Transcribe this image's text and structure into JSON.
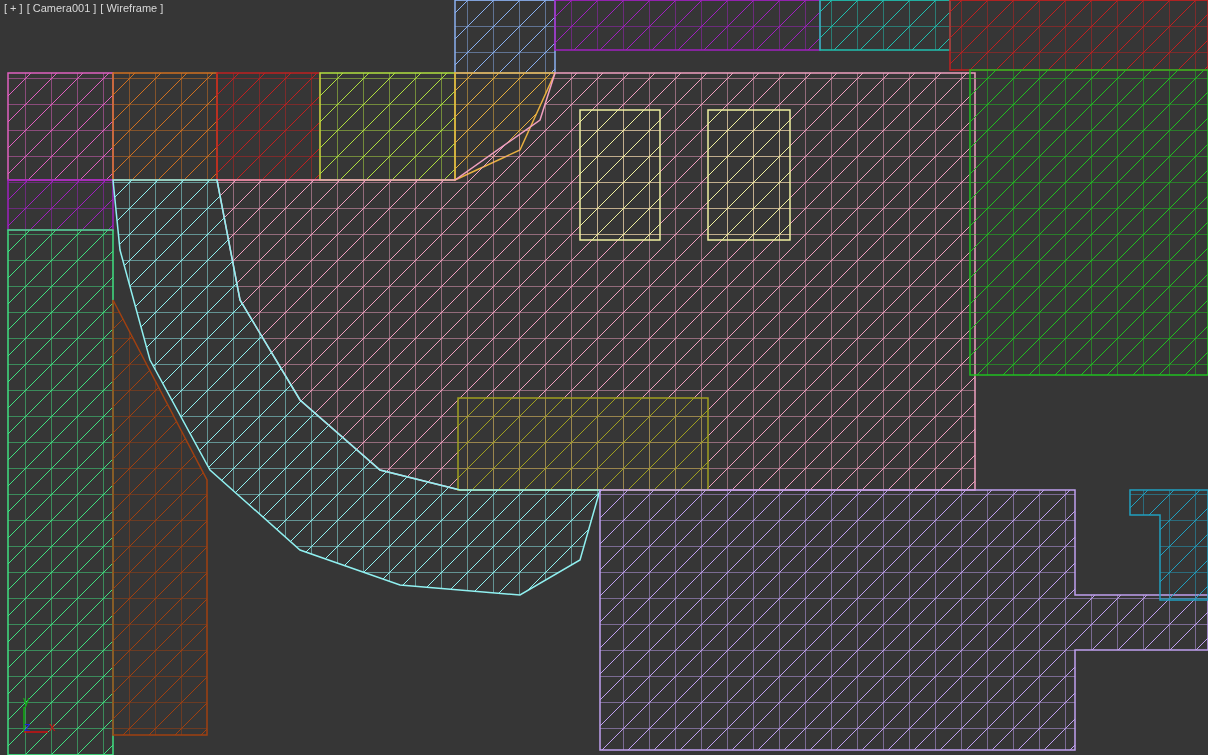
{
  "viewport": {
    "labels": [
      "[ + ]",
      "[ Camera001 ]",
      "[ Wireframe ]"
    ],
    "axis_gizmo": {
      "labels": [
        {
          "kind": "y",
          "text": "y"
        },
        {
          "kind": "z",
          "text": "z"
        },
        {
          "kind": "x",
          "text": "x"
        }
      ]
    }
  }
}
